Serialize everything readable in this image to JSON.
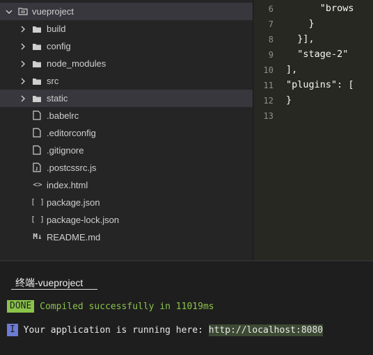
{
  "sidebar": {
    "root": {
      "label": "vueproject",
      "icon": "root-folder-icon"
    },
    "folders": [
      {
        "label": "build",
        "icon": "folder-icon"
      },
      {
        "label": "config",
        "icon": "folder-icon"
      },
      {
        "label": "node_modules",
        "icon": "folder-icon"
      },
      {
        "label": "src",
        "icon": "folder-icon"
      },
      {
        "label": "static",
        "icon": "folder-icon",
        "selected": true
      }
    ],
    "files": [
      {
        "label": ".babelrc",
        "icon": "file-icon"
      },
      {
        "label": ".editorconfig",
        "icon": "file-icon"
      },
      {
        "label": ".gitignore",
        "icon": "file-icon"
      },
      {
        "label": ".postcssrc.js",
        "icon": "js-file-icon"
      },
      {
        "label": "index.html",
        "icon": "html-file-icon",
        "glyph": "<>"
      },
      {
        "label": "package.json",
        "icon": "json-file-icon",
        "glyph": "[ ]"
      },
      {
        "label": "package-lock.json",
        "icon": "json-file-icon",
        "glyph": "[ ]"
      },
      {
        "label": "README.md",
        "icon": "markdown-file-icon",
        "glyph": "M↓"
      }
    ]
  },
  "editor": {
    "line_numbers": [
      "6",
      "7",
      "8",
      "9",
      "10",
      "11",
      "12",
      "13"
    ],
    "lines": [
      "      \"brows",
      "    }",
      "  }],",
      "  \"stage-2\"",
      "],",
      "\"plugins\": [",
      "}",
      ""
    ]
  },
  "terminal": {
    "tab_label": "终端-vueproject",
    "done_badge": "DONE",
    "done_message": "Compiled successfully in 11019ms",
    "info_badge": "I",
    "info_message": "Your application is running here: ",
    "url": "http://localhost:8080"
  },
  "colors": {
    "sidebar_bg": "#252526",
    "editor_bg": "#272822",
    "terminal_bg": "#1e1e1e",
    "done_green": "#8bc34a",
    "info_blue": "#6b7bd6"
  }
}
